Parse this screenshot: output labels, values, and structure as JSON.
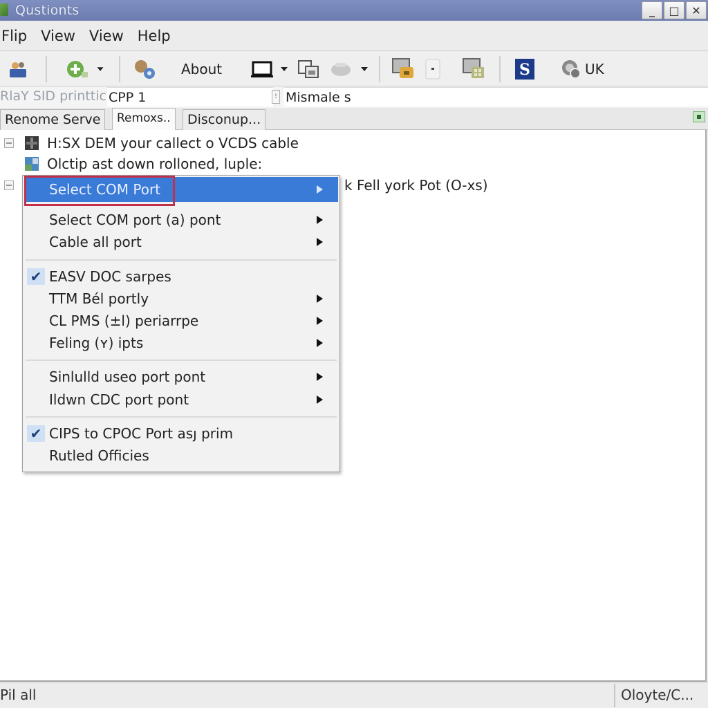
{
  "window": {
    "title": "Qustionts",
    "controls": {
      "minimize": "_",
      "maximize": "□",
      "close": "✕"
    }
  },
  "menubar": {
    "items": [
      "Flip",
      "View",
      "View",
      "Help"
    ]
  },
  "toolbar": {
    "about_label": "About",
    "region_label": "UK",
    "icons": [
      "users-icon",
      "add-icon",
      "settings-gears-icon",
      "monitor-icon",
      "copy-window-icon",
      "printer-icon",
      "folder-network-icon",
      "small-button-icon",
      "window-grid-icon",
      "s-logo-icon",
      "globe-icon"
    ]
  },
  "address": {
    "label": "RlaY SID printtic",
    "field_value": "CPP 1",
    "spin_glyph": "⁝",
    "second_field_value": "Mismale s"
  },
  "tabs": [
    {
      "label": "Renome Serve",
      "active": false
    },
    {
      "label": "Remoxs..",
      "active": true
    },
    {
      "label": "Disconup...",
      "active": false
    }
  ],
  "tree": {
    "rows": [
      {
        "text": "H:SX DEM your callect o VCDS cable",
        "has_expander": true
      },
      {
        "text": "Olctip ast down rolloned, luple:",
        "has_expander": false
      },
      {
        "text": "k Fell york Pot (O-xs)",
        "has_expander": true
      }
    ]
  },
  "context_menu": {
    "items": [
      {
        "label": "Select COM Port",
        "submenu": true,
        "highlighted": true,
        "checked": false
      },
      {
        "label": "Select COM port (a) pont",
        "submenu": true,
        "checked": false
      },
      {
        "label": "Cable all port",
        "submenu": true,
        "checked": false
      },
      {
        "label": "EASV DOC sarpes",
        "submenu": false,
        "checked": true
      },
      {
        "label": "TTM Bél portly",
        "submenu": true,
        "checked": false
      },
      {
        "label": "CL PMS (±l) periarrpe",
        "submenu": true,
        "checked": false
      },
      {
        "label": "Feling (ʏ) ipts",
        "submenu": true,
        "checked": false
      },
      {
        "label": "Sinlulld useo port pont",
        "submenu": true,
        "checked": false
      },
      {
        "label": "Ildwn CDC port pont",
        "submenu": true,
        "checked": false
      },
      {
        "label": "CIPS to CPOC Port asȷ prim",
        "submenu": false,
        "checked": true
      },
      {
        "label": "Rutled Officies",
        "submenu": false,
        "checked": false
      }
    ],
    "check_glyph": "✔"
  },
  "statusbar": {
    "left": "Pil all",
    "right": "Oloyte/C..."
  },
  "colors": {
    "titlebar": "#7585b8",
    "highlight": "#3b7bd8",
    "highlight_outline": "#c0304a"
  }
}
